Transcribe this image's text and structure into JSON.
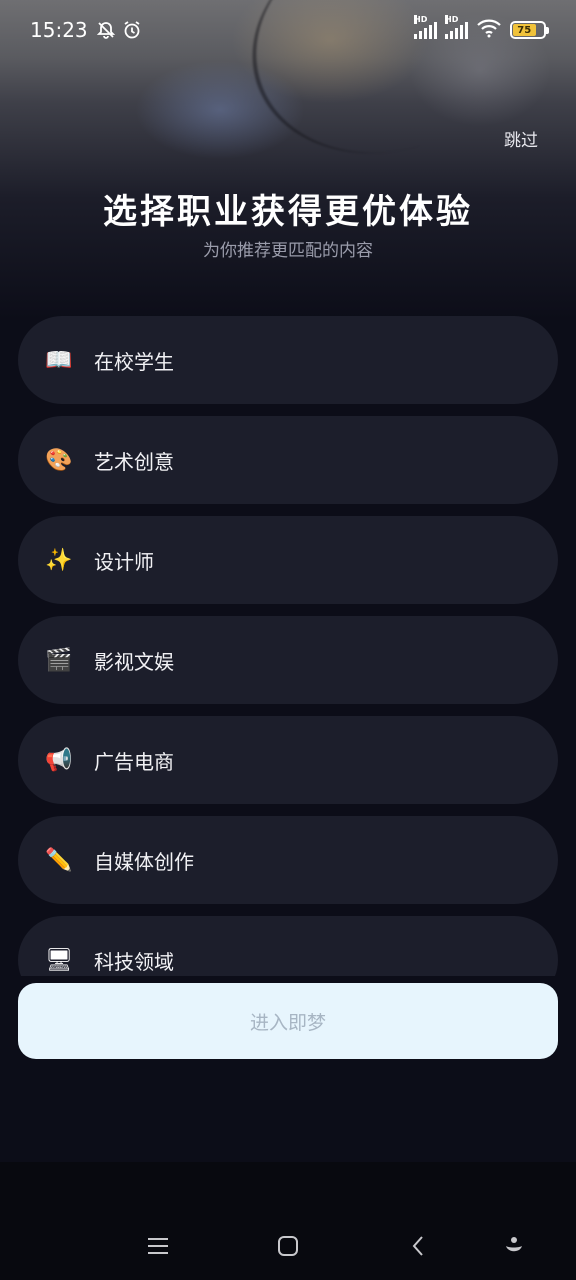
{
  "status": {
    "time": "15:23",
    "battery": "75",
    "icons": [
      "mute-bell-icon",
      "alarm-icon",
      "signal-hd-icon",
      "signal-hd-icon",
      "wifi-icon",
      "battery-icon"
    ]
  },
  "header": {
    "skip_label": "跳过",
    "title": "选择职业获得更优体验",
    "subtitle": "为你推荐更匹配的内容"
  },
  "options": [
    {
      "icon": "📖",
      "icon_name": "book-icon",
      "label": "在校学生"
    },
    {
      "icon": "🎨",
      "icon_name": "palette-icon",
      "label": "艺术创意"
    },
    {
      "icon": "✨",
      "icon_name": "sparkles-icon",
      "label": "设计师"
    },
    {
      "icon": "🎬",
      "icon_name": "clapper-icon",
      "label": "影视文娱"
    },
    {
      "icon": "📢",
      "icon_name": "megaphone-icon",
      "label": "广告电商"
    },
    {
      "icon": "✏️",
      "icon_name": "pencil-icon",
      "label": "自媒体创作"
    },
    {
      "icon": "🖥",
      "icon_name": "monitor-icon",
      "label": "科技领域"
    }
  ],
  "cta": {
    "enter_label": "进入即梦"
  },
  "navbar": {
    "icons": [
      "menu-icon",
      "home-icon",
      "back-icon",
      "assistant-icon"
    ]
  },
  "colors": {
    "background": "#0c0d18",
    "option_bg": "#1c1e2b",
    "cta_bg": "#e7f5fd",
    "cta_text": "#a7b5c3",
    "battery": "#f0c23a"
  }
}
